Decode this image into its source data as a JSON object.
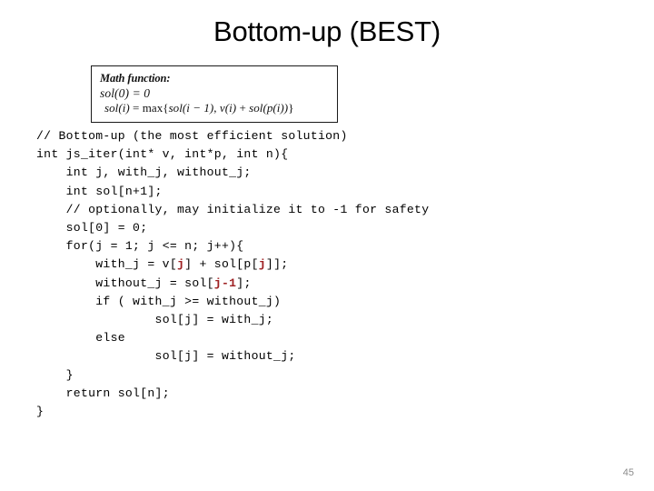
{
  "slide": {
    "title": "Bottom-up (BEST)",
    "page_number": "45",
    "background_color": "#ffffff",
    "title_color": "#000000",
    "highlight_color": "#9e2022",
    "page_number_color": "#8c8c8c"
  },
  "math_box": {
    "heading": "Math function:",
    "equation_1": "sol(0) = 0",
    "equation_2_parts": {
      "lhs": "sol(i)",
      "equals": " = ",
      "max": "max",
      "brace_open": "{",
      "term_1": "sol(i − 1)",
      "comma": ", ",
      "term_2": "v(i)",
      "plus": " + ",
      "term_3": "sol(p(i))",
      "brace_close": "}"
    },
    "equation_2_plain": "sol(i) = max{sol(i − 1), v(i) + sol(p(i))}",
    "border_color": "#1a1a1a"
  },
  "code": {
    "language": "c",
    "lines": [
      {
        "indent": 0,
        "segments": [
          {
            "text": "// Bottom-up (the most efficient solution)",
            "highlight": false
          }
        ]
      },
      {
        "indent": 0,
        "segments": [
          {
            "text": "int js_iter(int* v, int*p, int n){",
            "highlight": false
          }
        ]
      },
      {
        "indent": 4,
        "segments": [
          {
            "text": "int j, with_j, without_j;",
            "highlight": false
          }
        ]
      },
      {
        "indent": 4,
        "segments": [
          {
            "text": "int sol[n+1];",
            "highlight": false
          }
        ]
      },
      {
        "indent": 4,
        "segments": [
          {
            "text": "// optionally, may initialize it to -1 for safety",
            "highlight": false
          }
        ]
      },
      {
        "indent": 4,
        "segments": [
          {
            "text": "sol[0] = 0;",
            "highlight": false
          }
        ]
      },
      {
        "indent": 4,
        "segments": [
          {
            "text": "for(j = 1; j <= n; j++){",
            "highlight": false
          }
        ]
      },
      {
        "indent": 8,
        "segments": [
          {
            "text": "with_j = v[",
            "highlight": false
          },
          {
            "text": "j",
            "highlight": true
          },
          {
            "text": "] + sol[p[",
            "highlight": false
          },
          {
            "text": "j",
            "highlight": true
          },
          {
            "text": "]];",
            "highlight": false
          }
        ]
      },
      {
        "indent": 8,
        "segments": [
          {
            "text": "without_j = sol[",
            "highlight": false
          },
          {
            "text": "j-1",
            "highlight": true
          },
          {
            "text": "];",
            "highlight": false
          }
        ]
      },
      {
        "indent": 8,
        "segments": [
          {
            "text": "if ( with_j >= without_j)",
            "highlight": false
          }
        ]
      },
      {
        "indent": 16,
        "segments": [
          {
            "text": "sol[j] = with_j;",
            "highlight": false
          }
        ]
      },
      {
        "indent": 8,
        "segments": [
          {
            "text": "else",
            "highlight": false
          }
        ]
      },
      {
        "indent": 16,
        "segments": [
          {
            "text": "sol[j] = without_j;",
            "highlight": false
          }
        ]
      },
      {
        "indent": 4,
        "segments": [
          {
            "text": "}",
            "highlight": false
          }
        ]
      },
      {
        "indent": 4,
        "segments": [
          {
            "text": "return sol[n];",
            "highlight": false
          }
        ]
      },
      {
        "indent": 0,
        "segments": [
          {
            "text": "}",
            "highlight": false
          }
        ]
      }
    ]
  }
}
